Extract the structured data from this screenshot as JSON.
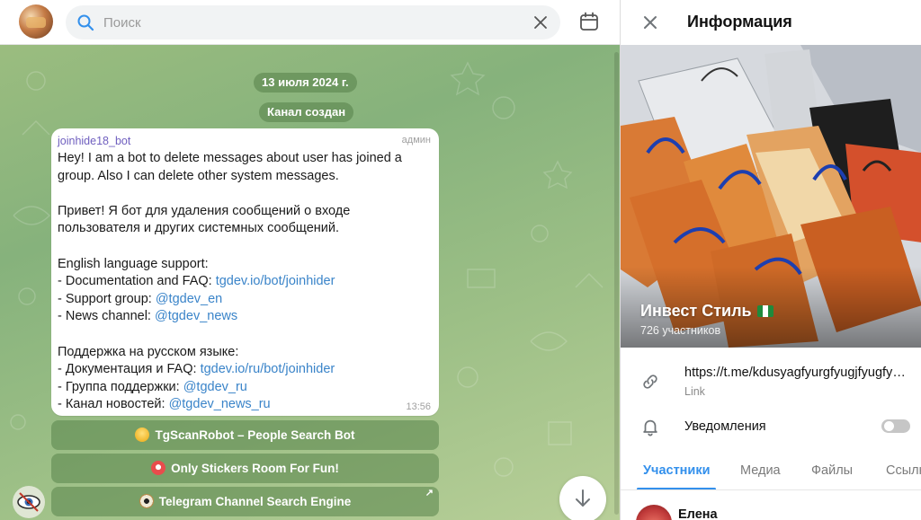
{
  "search": {
    "placeholder": "Поиск"
  },
  "chat": {
    "date_pill": "13 июля 2024 г.",
    "service_message": "Канал создан",
    "message": {
      "sender": "joinhide18_bot",
      "role": "админ",
      "time": "13:56",
      "line1": "Hey!  I am a bot to delete messages about user has joined a",
      "line2": "group. Also I can delete other system messages.",
      "line3": "Привет! Я бот для удаления сообщений о входе",
      "line4": "пользователя и других системных сообщений.",
      "line5": "English language support:",
      "doc_label": " - Documentation and FAQ: ",
      "doc_link": "tgdev.io/bot/joinhider",
      "support_label": " - Support group: ",
      "support_link": "@tgdev_en",
      "news_label": " - News channel: ",
      "news_link": "@tgdev_news",
      "line6": "Поддержка на русском языке:",
      "doc_ru_label": " - Документация и FAQ: ",
      "doc_ru_link": "tgdev.io/ru/bot/joinhider",
      "support_ru_label": " - Группа поддержки: ",
      "support_ru_link": "@tgdev_ru",
      "news_ru_label": " - Канал новостей: ",
      "news_ru_link": "@tgdev_news_ru"
    },
    "buttons": [
      {
        "label": "TgScanRobot – People Search Bot"
      },
      {
        "label": "Only Stickers Room For Fun!"
      },
      {
        "label": "Telegram Channel Search Engine",
        "corner": "↗"
      }
    ]
  },
  "info": {
    "title": "Информация",
    "channel_name": "Инвест Стиль",
    "members": "726 участников",
    "link_url": "https://t.me/kdusyagfyurgfyugjfyugfyuegfyu",
    "link_label": "Link",
    "notifications_label": "Уведомления",
    "notifications_on": false,
    "tabs": [
      "Участники",
      "Медиа",
      "Файлы",
      "Ссылки"
    ],
    "active_tab": 0,
    "first_member": "Елена"
  },
  "colors": {
    "accent": "#3390ec",
    "link": "#3a84c9",
    "sender": "#6f5fbf"
  }
}
